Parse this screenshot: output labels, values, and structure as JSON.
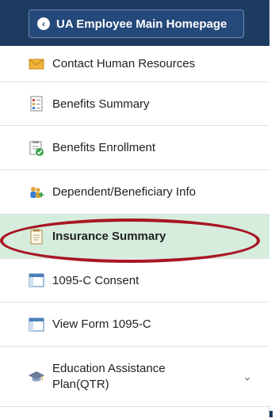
{
  "header": {
    "back_button_label": "UA Employee Main Homepage"
  },
  "menu": {
    "items": [
      {
        "label": "Contact Human Resources",
        "icon": "envelope-icon"
      },
      {
        "label": "Benefits Summary",
        "icon": "benefits-summary-icon"
      },
      {
        "label": "Benefits Enrollment",
        "icon": "enrollment-checklist-icon"
      },
      {
        "label": "Dependent/Beneficiary Info",
        "icon": "people-plus-icon"
      },
      {
        "label": "Insurance Summary",
        "icon": "clipboard-icon"
      },
      {
        "label": "1095-C Consent",
        "icon": "window-icon"
      },
      {
        "label": "View Form 1095-C",
        "icon": "window-icon"
      },
      {
        "label": "Education Assistance Plan(QTR)",
        "icon": "graduation-cap-icon"
      }
    ],
    "selected_index": 4
  },
  "colors": {
    "header_bg": "#1d3b60",
    "selected_bg": "#d6eddd",
    "annotation_ellipse": "#a81623"
  }
}
